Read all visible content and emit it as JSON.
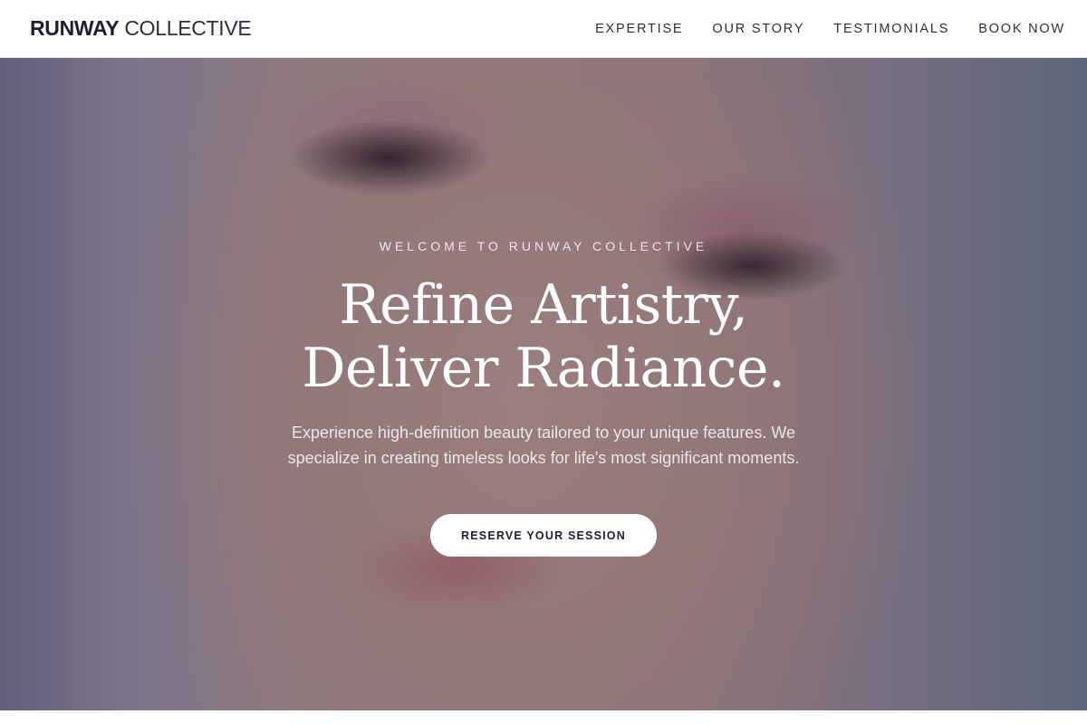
{
  "brand": {
    "bold": "RUNWAY",
    "light": "COLLECTIVE"
  },
  "nav": {
    "links": [
      "EXPERTISE",
      "OUR STORY",
      "TESTIMONIALS",
      "BOOK NOW"
    ]
  },
  "hero": {
    "eyebrow": "WELCOME TO RUNWAY COLLECTIVE",
    "headline_line1": "Refine Artistry,",
    "headline_line2": "Deliver Radiance.",
    "subtext": "Experience high-definition beauty tailored to your unique features. We specialize in creating timeless looks for life's most significant moments.",
    "cta_label": "RESERVE YOUR SESSION",
    "background_image": "close-up-portrait-with-dramatic-eye-makeup"
  },
  "colors": {
    "text_dark": "#1b2030",
    "overlay": "#282434",
    "button_bg": "#ffffff"
  }
}
